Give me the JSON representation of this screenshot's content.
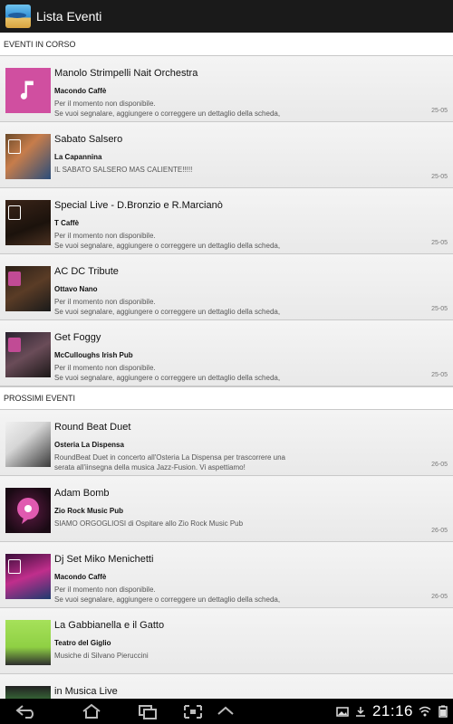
{
  "header": {
    "title": "Lista Eventi"
  },
  "sections": [
    {
      "label": "EVENTI IN CORSO",
      "items": [
        {
          "title": "Manolo Strimpelli Nait Orchestra",
          "venue": "Macondo Caffè",
          "desc1": "Per il momento non disponibile.",
          "desc2": "Se vuoi segnalare, aggiungere o correggere un dettaglio della scheda,",
          "date": "25-05",
          "thumb": "music-note-thumbnail"
        },
        {
          "title": "Sabato Salsero",
          "venue": "La Capannina",
          "desc1": "IL SABATO SALSERO MAS CALIENTE!!!!!",
          "desc2": "",
          "date": "25-05",
          "thumb": "photo-thumbnail"
        },
        {
          "title": "Special Live - D.Bronzio e R.Marcianò",
          "venue": "T Caffè",
          "desc1": "Per il momento non disponibile.",
          "desc2": "Se vuoi segnalare, aggiungere o correggere un dettaglio della scheda,",
          "date": "25-05",
          "thumb": "photo-thumbnail"
        },
        {
          "title": "AC DC Tribute",
          "venue": "Ottavo Nano",
          "desc1": "Per il momento non disponibile.",
          "desc2": "Se vuoi segnalare, aggiungere o correggere un dettaglio della scheda,",
          "date": "25-05",
          "thumb": "photo-thumbnail"
        },
        {
          "title": "Get Foggy",
          "venue": "McCulloughs Irish Pub",
          "desc1": "Per il momento non disponibile.",
          "desc2": "Se vuoi segnalare, aggiungere o correggere un dettaglio della scheda,",
          "date": "25-05",
          "thumb": "photo-thumbnail"
        }
      ]
    },
    {
      "label": "PROSSIMI EVENTI",
      "items": [
        {
          "title": "Round Beat Duet",
          "venue": "Osteria La Dispensa",
          "desc1": "RoundBeat Duet in concerto all'Osteria La Dispensa per trascorrere una",
          "desc2": "serata all'iinsegna della musica Jazz-Fusion. Vi aspettiamo!",
          "date": "26-05",
          "thumb": "photo-thumbnail"
        },
        {
          "title": "Adam Bomb",
          "venue": "Zio Rock Music Pub",
          "desc1": "SIAMO ORGOGLIOSI di Ospitare allo Zio Rock Music Pub",
          "desc2": "",
          "date": "26-05",
          "thumb": "photo-thumbnail"
        },
        {
          "title": "Dj Set Miko Menichetti",
          "venue": "Macondo Caffè",
          "desc1": "Per il momento non disponibile.",
          "desc2": "Se vuoi segnalare, aggiungere o correggere un dettaglio della scheda,",
          "date": "26-05",
          "thumb": "photo-thumbnail"
        },
        {
          "title": "La Gabbianella e il Gatto",
          "venue": "Teatro del Giglio",
          "desc1": "Musiche di Silvano Pieruccini",
          "desc2": "",
          "date": "",
          "thumb": "photo-thumbnail"
        },
        {
          "title": "in Musica Live",
          "venue": "",
          "desc1": "",
          "desc2": "",
          "date": "",
          "thumb": "photo-thumbnail"
        }
      ]
    }
  ],
  "status": {
    "clock": "21:16"
  },
  "colors": {
    "accent": "#d04fa0",
    "actionbar": "#1a1a1a",
    "navbar": "#000000"
  }
}
